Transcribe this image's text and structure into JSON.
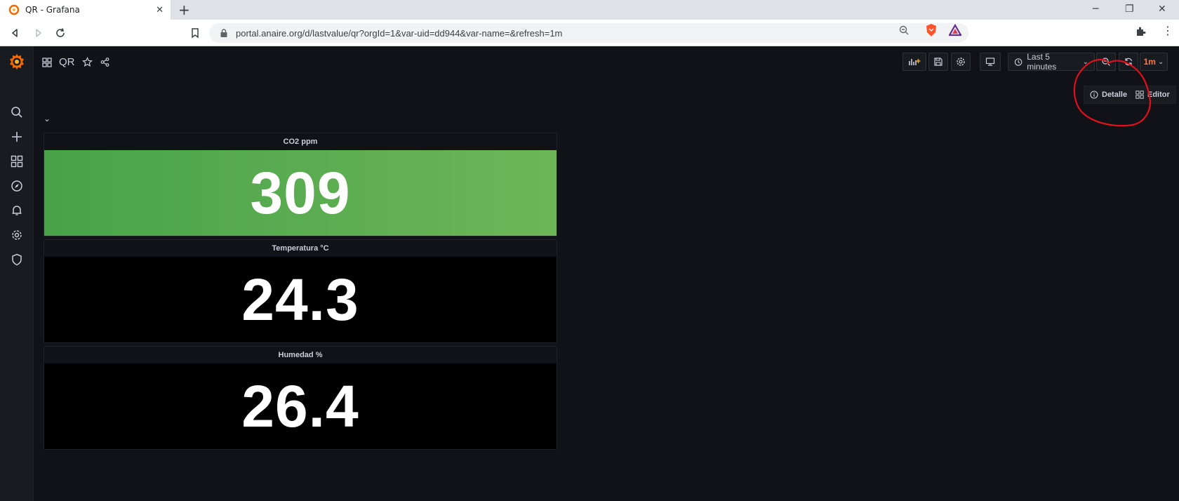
{
  "browser": {
    "tab_title": "QR - Grafana",
    "tab_close": "✕",
    "new_tab": "+",
    "url": "portal.anaire.org/d/lastvalue/qr?orgId=1&var-uid=dd944&var-name=&refresh=1m",
    "window_controls": [
      "─",
      "❐",
      "✕"
    ]
  },
  "sidebar": {
    "items": [
      "search-icon",
      "plus-icon",
      "dashboards-icon",
      "explore-icon",
      "alerting-icon",
      "configuration-icon",
      "shield-icon"
    ]
  },
  "dashboard": {
    "title": "QR",
    "time_range": "Last 5 minutes",
    "refresh": "1m",
    "links": {
      "detalle": "Detalle",
      "editor": "Editor"
    },
    "row_toggle": "⌄"
  },
  "panels": [
    {
      "title": "CO2 ppm",
      "value": "309",
      "color": "#56a64b"
    },
    {
      "title": "Temperatura °C",
      "value": "24.3",
      "color": "#000000"
    },
    {
      "title": "Humedad %",
      "value": "26.4",
      "color": "#000000"
    }
  ],
  "colors": {
    "brand": "#f46800",
    "refresh_accent": "#ff7941",
    "annotation": "#e0101c"
  }
}
